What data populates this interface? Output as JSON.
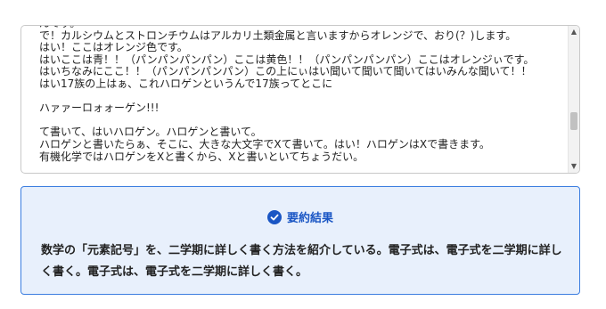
{
  "transcript": {
    "text": "んです。\nで！カルシウムとストロンチウムはアルカリ土類金属と言いますからオレンジで、おり(？)します。\nはい！ここはオレンジ色です。\nはいここは青！！（パンパンパンパン）ここは黄色！！（パンパンパンパン）ここはオレンジぃです。\nはいちなみにここ！！（パンパンパンパン）この上にぃはい聞いて聞いて聞いてはいみんな聞いて！！\nはい17族の上はぁ、これハロゲンというんで17族ってとこに\n\nハァァーロォォーゲン!!!\n\nて書いて、はいハロゲン。ハロゲンと書いて。\nハロゲンと書いたらぁ、そこに、大きな大文字でXて書いて。はい！ハロゲンはXで書きます。\n有機化学ではハロゲンをXと書くから、Xと書いといてちょうだい。"
  },
  "summary": {
    "title": "要約結果",
    "body": "数学の「元素記号」を、二学期に詳しく書く方法を紹介している。電子式は、電子式を二学期に詳しく書く。電子式は、電子式を二学期に詳しく書く。"
  },
  "icons": {
    "summary_icon": "check-circle-icon",
    "scroll_up": "chevron-up-icon",
    "scroll_down": "chevron-down-icon"
  },
  "colors": {
    "accent": "#1a56c4",
    "card_background": "#e8f0fc",
    "card_border": "#3b7de0"
  }
}
